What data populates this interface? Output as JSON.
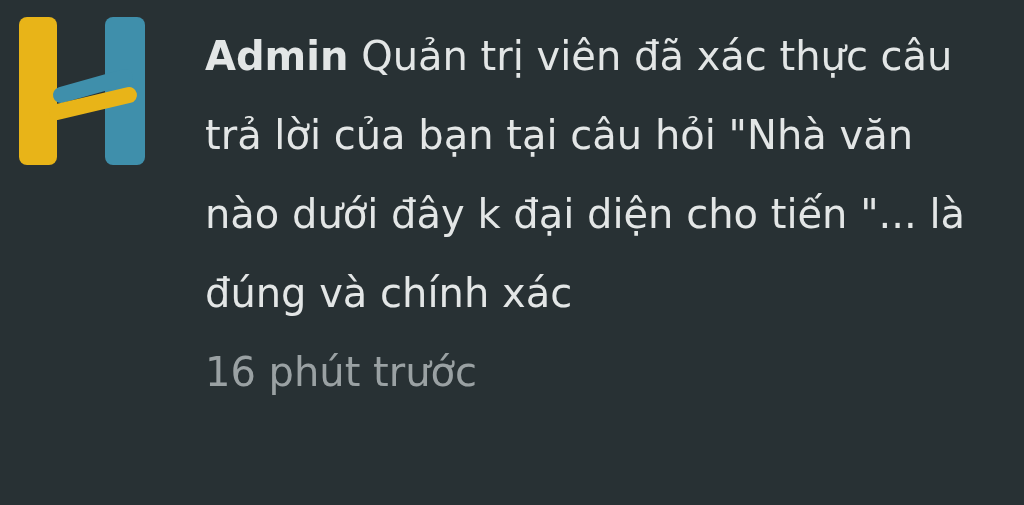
{
  "notification": {
    "message": "**Admin** Quản trị viên đã xác thực câu trả lời của bạn tại câu hỏi \"Nhà văn nào dưới đây k đại diện cho tiến \"... là đúng và chính xác",
    "time": "16 phút trước"
  }
}
